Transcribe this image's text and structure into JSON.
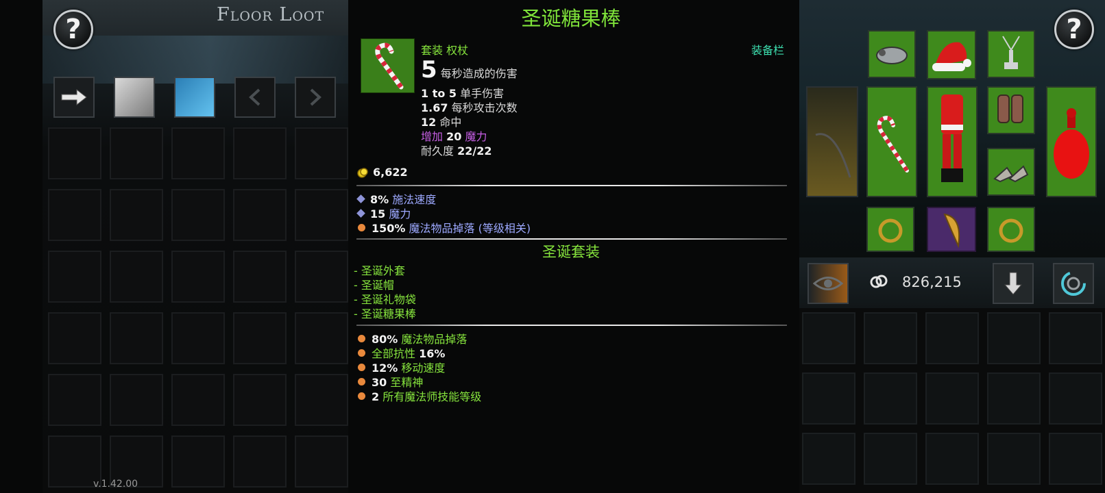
{
  "left": {
    "help_label": "?",
    "title": "Floor Loot",
    "version": "v.1.42.00"
  },
  "tooltip": {
    "item_name": "圣诞糖果棒",
    "type_label": "套装 权杖",
    "equip_tab_label": "装备栏",
    "dps_value": "5",
    "dps_label": "每秒造成的伤害",
    "damage_range": "1 to 5",
    "damage_label": "单手伤害",
    "attack_speed_value": "1.67",
    "attack_speed_label": "每秒攻击次数",
    "accuracy_value": "12",
    "accuracy_label": "命中",
    "bonus_prefix": "增加",
    "bonus_value": "20",
    "bonus_suffix": "魔力",
    "durability_label": "耐久度",
    "durability_value": "22/22",
    "price": "6,622",
    "stats": [
      {
        "value": "8%",
        "label": "施法速度"
      },
      {
        "value": "15",
        "label": "魔力"
      },
      {
        "value": "150%",
        "label": "魔法物品掉落 (等级相关)"
      }
    ],
    "set_name": "圣诞套装",
    "set_items": [
      "- 圣诞外套",
      "- 圣诞帽",
      "- 圣诞礼物袋",
      "- 圣诞糖果棒"
    ],
    "set_bonuses": [
      {
        "value": "80%",
        "label": "魔法物品掉落"
      },
      {
        "value_first": false,
        "label": "全部抗性",
        "value": "16%"
      },
      {
        "value": "12%",
        "label": "移动速度"
      },
      {
        "value": "30",
        "label": "至精神"
      },
      {
        "value": "2",
        "label": "所有魔法师技能等级"
      }
    ]
  },
  "right": {
    "help_label": "?",
    "gold": "826,215",
    "slots": {
      "amulet_left": "pet-figurine-icon",
      "helmet": "santa-hat-icon",
      "amulet": "hammer-pendant-icon",
      "offhand_bow": "bow-icon",
      "weapon": "candy-cane-icon",
      "armor": "santa-suit-icon",
      "gloves": "gloves-icon",
      "boots": "boots-icon",
      "bag": "gift-sack-icon",
      "ring_left": "ring-icon",
      "charm": "horn-icon",
      "ring_right": "ring-icon"
    }
  },
  "colors": {
    "title_green": "#7fe33a",
    "slot_green": "#3f8a1c",
    "magic_purple": "#c85fe6",
    "stat_blue": "#9da9ff",
    "bullet_orange": "#e9893c"
  }
}
